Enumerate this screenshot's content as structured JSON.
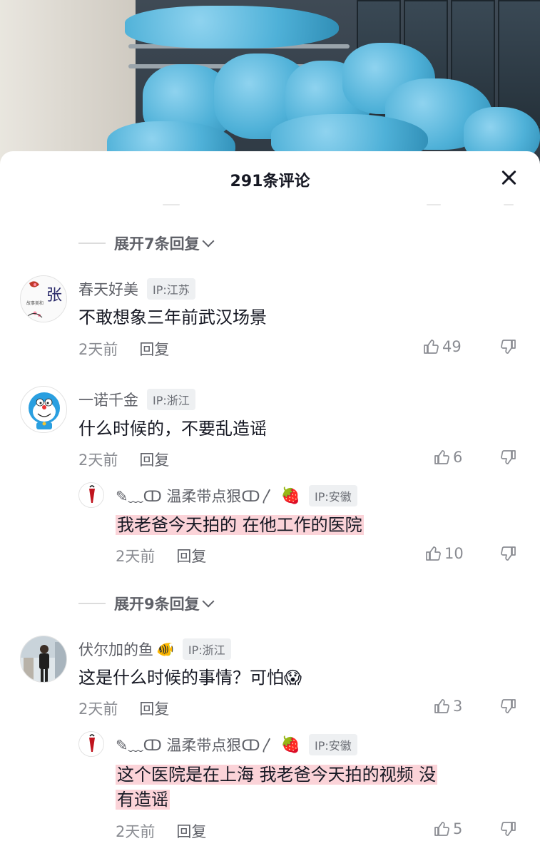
{
  "sheet": {
    "title": "291条评论"
  },
  "expands": [
    {
      "label": "展开7条回复"
    },
    {
      "label": "展开9条回复"
    }
  ],
  "comments": [
    {
      "username": "春天好美",
      "ip": "IP:江苏",
      "text": "不敢想象三年前武汉场景",
      "time": "2天前",
      "reply": "回复",
      "likes": "49"
    },
    {
      "username": "一诺千金",
      "ip": "IP:浙江",
      "text": "什么时候的，不要乱造谣",
      "time": "2天前",
      "reply": "回复",
      "likes": "6"
    },
    {
      "username": "伏尔加的鱼",
      "emoji": "🐠",
      "ip": "IP:浙江",
      "text": "这是什么时候的事情？可怕😱",
      "time": "2天前",
      "reply": "回复",
      "likes": "3"
    }
  ],
  "replies": [
    {
      "username": "✎﹏ↀ  温柔带点狠ↀ〳",
      "ip": "IP:安徽",
      "text": "我老爸今天拍的  在他工作的医院",
      "time": "2天前",
      "reply": "回复",
      "likes": "10"
    },
    {
      "username": "✎﹏ↀ  温柔带点狠ↀ〳",
      "ip": "IP:安徽",
      "text_line1": "这个医院是在上海  我老爸今天拍的视频  没",
      "text_line2": "有造谣",
      "time": "2天前",
      "reply": "回复",
      "likes": "5"
    }
  ],
  "colors": {
    "text_primary": "#161823",
    "text_secondary": "#8a8c92",
    "highlight": "#fbd3d8",
    "photo_blue": "#4fb1d8"
  }
}
